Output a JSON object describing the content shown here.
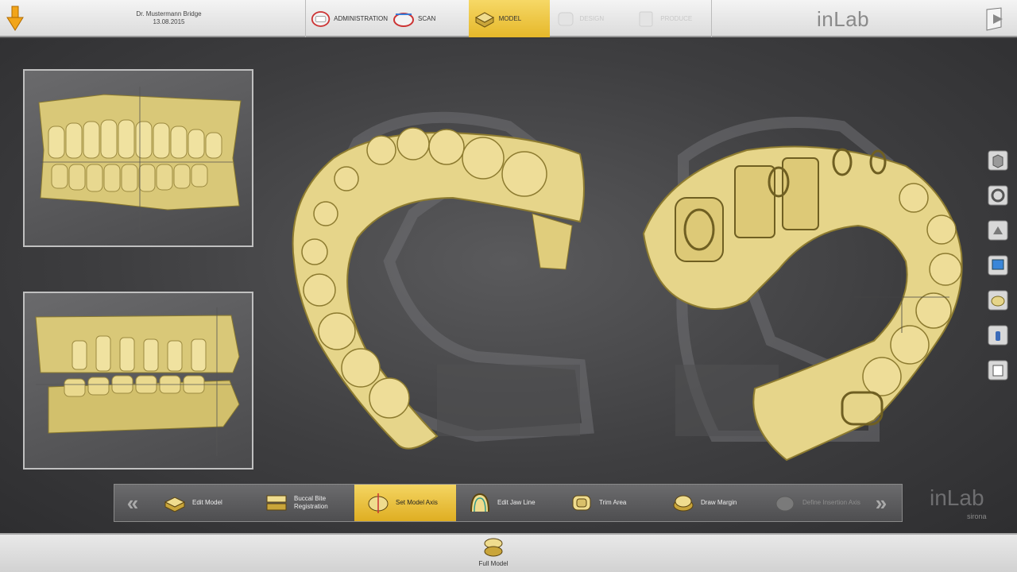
{
  "header": {
    "patient_name": "Dr. Mustermann Bridge",
    "date": "13.08.2015",
    "brand": "inLab"
  },
  "steps": [
    {
      "label": "ADMINISTRATION",
      "state": "normal",
      "icon": "administration-icon"
    },
    {
      "label": "SCAN",
      "state": "normal",
      "icon": "scan-icon"
    },
    {
      "label": "MODEL",
      "state": "active",
      "icon": "model-icon"
    },
    {
      "label": "DESIGN",
      "state": "disabled",
      "icon": "design-icon"
    },
    {
      "label": "PRODUCE",
      "state": "disabled",
      "icon": "produce-icon"
    }
  ],
  "toolbar": {
    "tools": [
      {
        "label": "Edit Model",
        "state": "normal"
      },
      {
        "label": "Buccal Bite Registration",
        "state": "normal"
      },
      {
        "label": "Set Model Axis",
        "state": "active"
      },
      {
        "label": "Edit Jaw Line",
        "state": "normal"
      },
      {
        "label": "Trim Area",
        "state": "normal"
      },
      {
        "label": "Draw Margin",
        "state": "normal"
      },
      {
        "label": "Define Insertion Axis",
        "state": "disabled"
      }
    ]
  },
  "right_tools": [
    "cube-view-icon",
    "rotate-icon",
    "tooth-view-icon",
    "screen-icon",
    "model-cast-icon",
    "bottle-icon",
    "book-icon"
  ],
  "bottom": {
    "full_model_label": "Full Model",
    "brand": "inLab",
    "sub_brand": "sirona"
  },
  "colors": {
    "accent": "#e8b92e",
    "tooth": "#e6d58a",
    "background": "#3e3e40"
  }
}
